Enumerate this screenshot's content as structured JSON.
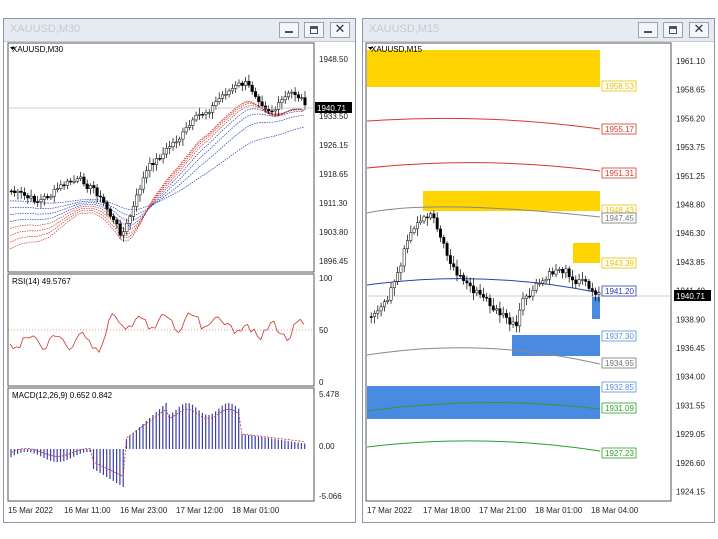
{
  "windows": {
    "left": {
      "title": "XAUUSD,M30",
      "symbol_label": "XAUUSD,M30",
      "price_axis": [
        "1948.50",
        "1933.50",
        "1926.15",
        "1918.65",
        "1911.30",
        "1903.80",
        "1896.45"
      ],
      "current_price": "1940.71",
      "rsi": {
        "label": "RSI(14) 49.5767",
        "axis": [
          "100",
          "50",
          "0"
        ]
      },
      "macd": {
        "label": "MACD(12,26,9) 0.652 0.842",
        "axis": [
          "5.478",
          "0.00",
          "-5.066"
        ]
      },
      "time_axis": [
        "15 Mar 2022",
        "16 Mar 11:00",
        "16 Mar 23:00",
        "17 Mar 12:00",
        "18 Mar 01:00"
      ]
    },
    "right": {
      "title": "XAUUSD,M15",
      "symbol_label": "XAUUSD,M15",
      "price_axis": [
        "1961.10",
        "1958.65",
        "1956.20",
        "1953.75",
        "1951.25",
        "1948.80",
        "1946.30",
        "1943.85",
        "1941.40",
        "1938.90",
        "1936.45",
        "1934.00",
        "1931.55",
        "1929.05",
        "1926.60",
        "1924.15"
      ],
      "current_price": "1940.71",
      "level_labels": [
        {
          "text": "1958.53",
          "color": "#e8c200",
          "fill": "#ffffff"
        },
        {
          "text": "1955.17",
          "color": "#d43a2a",
          "fill": "#ffffff"
        },
        {
          "text": "1951.31",
          "color": "#d43a2a",
          "fill": "#ffffff"
        },
        {
          "text": "1948.43",
          "color": "#e8c200",
          "fill": "#ffffff"
        },
        {
          "text": "1947.45",
          "color": "#777777",
          "fill": "#ffffff"
        },
        {
          "text": "1943.39",
          "color": "#e8c200",
          "fill": "#ffffff"
        },
        {
          "text": "1941.20",
          "color": "#2a3fb0",
          "fill": "#ffffff"
        },
        {
          "text": "1937.30",
          "color": "#5a8fdc",
          "fill": "#ffffff"
        },
        {
          "text": "1934.95",
          "color": "#777777",
          "fill": "#ffffff"
        },
        {
          "text": "1932.85",
          "color": "#5a8fdc",
          "fill": "#ffffff"
        },
        {
          "text": "1931.09",
          "color": "#2aa02a",
          "fill": "#ffffff"
        },
        {
          "text": "1927.23",
          "color": "#2aa02a",
          "fill": "#ffffff"
        }
      ],
      "time_axis": [
        "17 Mar 2022",
        "17 Mar 18:00",
        "17 Mar 21:00",
        "18 Mar 01:00",
        "18 Mar 04:00"
      ]
    }
  },
  "colors": {
    "zone_supply": "#ffd400",
    "zone_demand": "#4a8ae0",
    "ma_red": "#c9342a",
    "ma_blue": "#2a3fb0",
    "macd_hist": "#3b3fa8",
    "rsi_line": "#c9342a",
    "price_tag": "#000000"
  }
}
